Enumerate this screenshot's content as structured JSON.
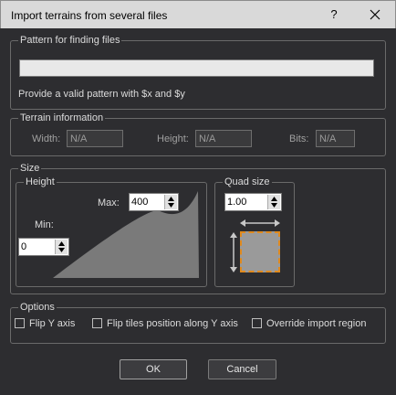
{
  "window": {
    "title": "Import terrains from several files",
    "help_label": "?"
  },
  "pattern": {
    "legend": "Pattern for finding files",
    "value": "",
    "hint": "Provide a valid pattern with $x and $y"
  },
  "terrain_info": {
    "legend": "Terrain information",
    "width_label": "Width:",
    "width_value": "N/A",
    "height_label": "Height:",
    "height_value": "N/A",
    "bits_label": "Bits:",
    "bits_value": "N/A"
  },
  "size": {
    "legend": "Size",
    "height_group": {
      "legend": "Height",
      "max_label": "Max:",
      "max_value": "400",
      "min_label": "Min:",
      "min_value": "0"
    },
    "quad_group": {
      "legend": "Quad size",
      "value": "1.00"
    }
  },
  "options": {
    "legend": "Options",
    "flip_y": {
      "label": "Flip Y axis",
      "checked": false
    },
    "flip_tiles": {
      "label": "Flip tiles position along Y axis",
      "checked": false
    },
    "override_region": {
      "label": "Override import region",
      "checked": false
    }
  },
  "buttons": {
    "ok": "OK",
    "cancel": "Cancel"
  },
  "colors": {
    "background": "#2d2d30",
    "titlebar": "#d9d9d9",
    "quad_fill": "#9a9a9a",
    "quad_border": "#e08a1e",
    "height_shape": "#7a7a7a"
  },
  "icons": [
    "close-icon",
    "spin-up-icon",
    "spin-down-icon",
    "horizontal-arrow-icon",
    "vertical-arrow-icon"
  ]
}
